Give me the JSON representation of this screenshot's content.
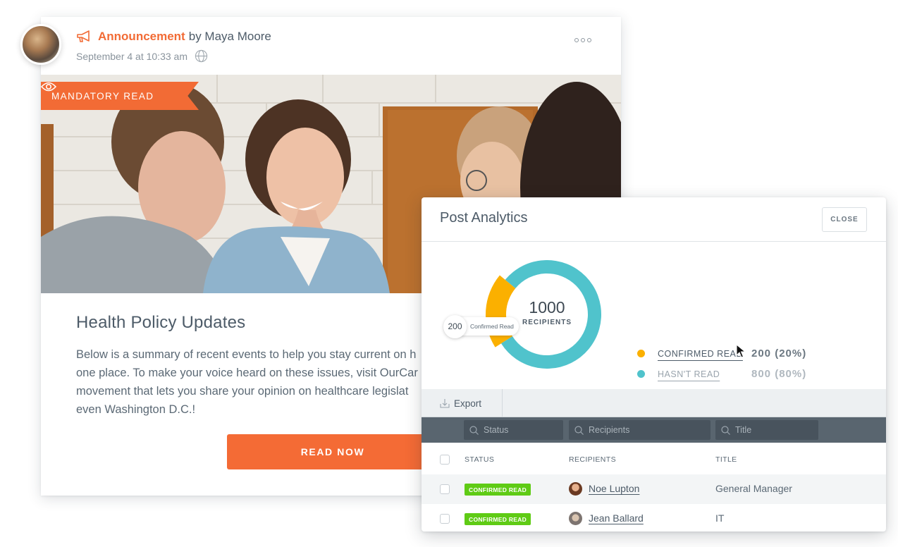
{
  "post": {
    "type_label": "Announcement",
    "byline": "by Maya Moore",
    "timestamp": "September 4 at 10:33 am",
    "visibility_icon": "globe-icon",
    "more_icon": "more-options-icon",
    "ribbon_label": "MANDATORY READ",
    "title": "Health Policy Updates",
    "body_lines": [
      "Below is a summary of recent events to help you stay current on h",
      "one place. To make your voice heard on these issues, visit OurCar",
      "movement that lets you share your opinion on healthcare legislat",
      "even Washington D.C.!"
    ],
    "cta_label": "READ NOW"
  },
  "colors": {
    "brand_orange": "#f26b35",
    "confirmed": "#fbb000",
    "not_read": "#50c3cc",
    "badge_green": "#5fcb15"
  },
  "analytics": {
    "title": "Post Analytics",
    "close_label": "CLOSE",
    "total": "1000",
    "total_label": "RECIPIENTS",
    "tooltip_value": "200",
    "tooltip_label": "Confirmed Read",
    "legend": [
      {
        "label": "CONFIRMED READ",
        "value": "200 (20%)"
      },
      {
        "label": "HASN'T READ",
        "value": "800 (80%)"
      }
    ],
    "export_label": "Export",
    "filters": {
      "status_placeholder": "Status",
      "recipients_placeholder": "Recipients",
      "title_placeholder": "Title"
    },
    "columns": [
      "STATUS",
      "RECIPIENTS",
      "TITLE"
    ],
    "rows": [
      {
        "status": "CONFIRMED READ",
        "name": "Noe Lupton",
        "title": "General Manager"
      },
      {
        "status": "CONFIRMED READ",
        "name": "Jean Ballard",
        "title": "IT"
      }
    ]
  },
  "chart_data": {
    "type": "pie",
    "title": "1000 RECIPIENTS",
    "categories": [
      "Confirmed Read",
      "Hasn't Read"
    ],
    "values": [
      200,
      800
    ],
    "percentages": [
      20,
      80
    ],
    "colors": [
      "#fbb000",
      "#50c3cc"
    ],
    "highlighted": "Confirmed Read",
    "legend_position": "right"
  }
}
